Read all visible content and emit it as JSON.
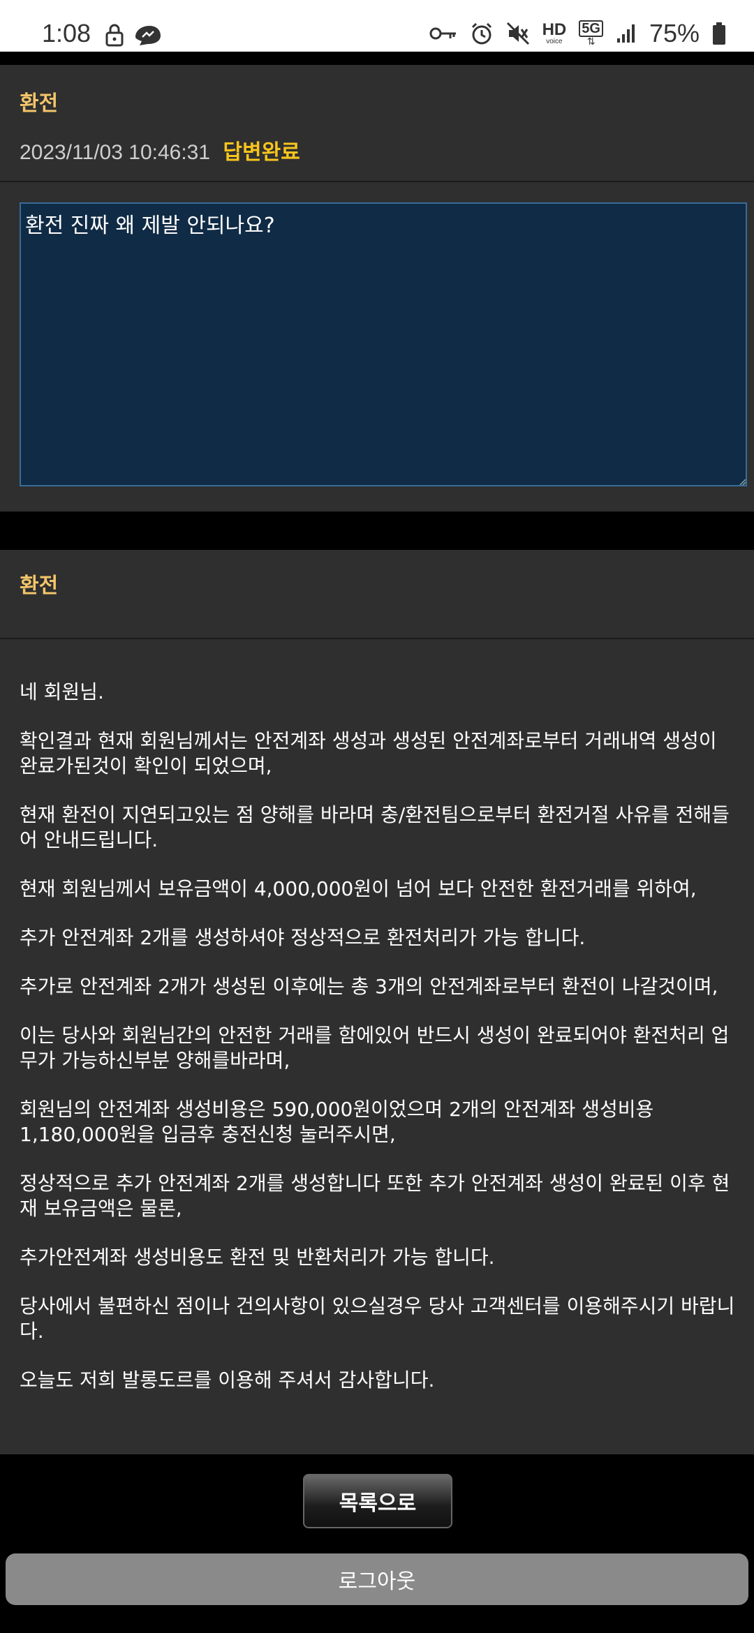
{
  "status_bar": {
    "time": "1:08",
    "battery": "75%",
    "hd": "HD",
    "voice": "voice",
    "network": "5G"
  },
  "question": {
    "title": "환전",
    "datetime": "2023/11/03 10:46:31",
    "status": "답변완료",
    "content": "환전 진짜 왜 제발 안되나요?"
  },
  "answer": {
    "title": "환전",
    "paragraphs": [
      "네 회원님.",
      "확인결과 현재 회원님께서는 안전계좌 생성과 생성된 안전계좌로부터 거래내역 생성이 완료가된것이 확인이 되었으며,",
      "현재 환전이 지연되고있는 점 양해를 바라며 충/환전팀으로부터 환전거절 사유를 전해들어 안내드립니다.",
      "현재 회원님께서 보유금액이 4,000,000원이 넘어 보다 안전한 환전거래를 위하여,",
      "추가 안전계좌 2개를 생성하셔야 정상적으로 환전처리가 가능 합니다.",
      "추가로 안전계좌 2개가 생성된 이후에는 총 3개의 안전계좌로부터 환전이 나갈것이며,",
      "이는 당사와 회원님간의 안전한 거래를 함에있어 반드시 생성이 완료되어야 환전처리 업무가 가능하신부분 양해를바라며,",
      "회원님의 안전계좌 생성비용은 590,000원이었으며 2개의 안전계좌 생성비용 1,180,000원을 입금후 충전신청 눌러주시면,",
      "정상적으로 추가 안전계좌 2개를 생성합니다 또한 추가 안전계좌 생성이 완료된 이후 현재 보유금액은 물론,",
      "추가안전계좌 생성비용도 환전 및 반환처리가 가능 합니다.",
      "당사에서 불편하신 점이나 건의사항이 있으실경우 당사 고객센터를 이용해주시기 바랍니다.",
      "오늘도 저희 발롱도르를 이용해 주셔서 감사합니다."
    ]
  },
  "buttons": {
    "back_to_list": "목록으로",
    "logout": "로그아웃"
  },
  "colors": {
    "accent_title": "#f3c56a",
    "status_complete": "#f7c51d",
    "textarea_bg": "#102b45",
    "card_bg": "#2f2f2f"
  }
}
